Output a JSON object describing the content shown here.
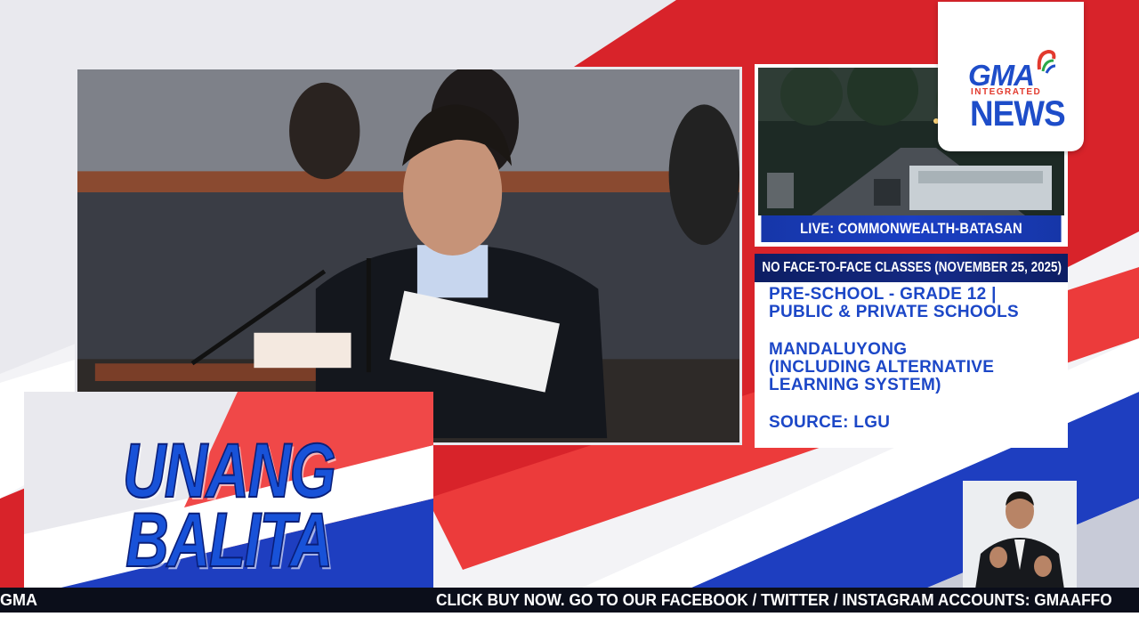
{
  "live": {
    "label": "LIVE: COMMONWEALTH-BATASAN"
  },
  "info": {
    "header": "NO FACE-TO-FACE CLASSES (NOVEMBER 25, 2025)",
    "line1": "PRE-SCHOOL - GRADE 12 |\nPUBLIC & PRIVATE SCHOOLS",
    "line2": "MANDALUYONG\n(INCLUDING ALTERNATIVE\nLEARNING SYSTEM)",
    "line3": "SOURCE: LGU"
  },
  "logo": {
    "gma": "GMA",
    "integrated": "INTEGRATED",
    "news": "NEWS"
  },
  "show": {
    "line1": "UNANG",
    "line2": "BALITA"
  },
  "ticker": {
    "left": "GMA",
    "text": "CLICK BUY NOW. GO TO OUR FACEBOOK / TWITTER / INSTAGRAM ACCOUNTS: GMAAFFO"
  },
  "colors": {
    "brand_blue": "#1c47c7",
    "brand_red": "#d8232a",
    "header_navy": "#0d1e63"
  }
}
